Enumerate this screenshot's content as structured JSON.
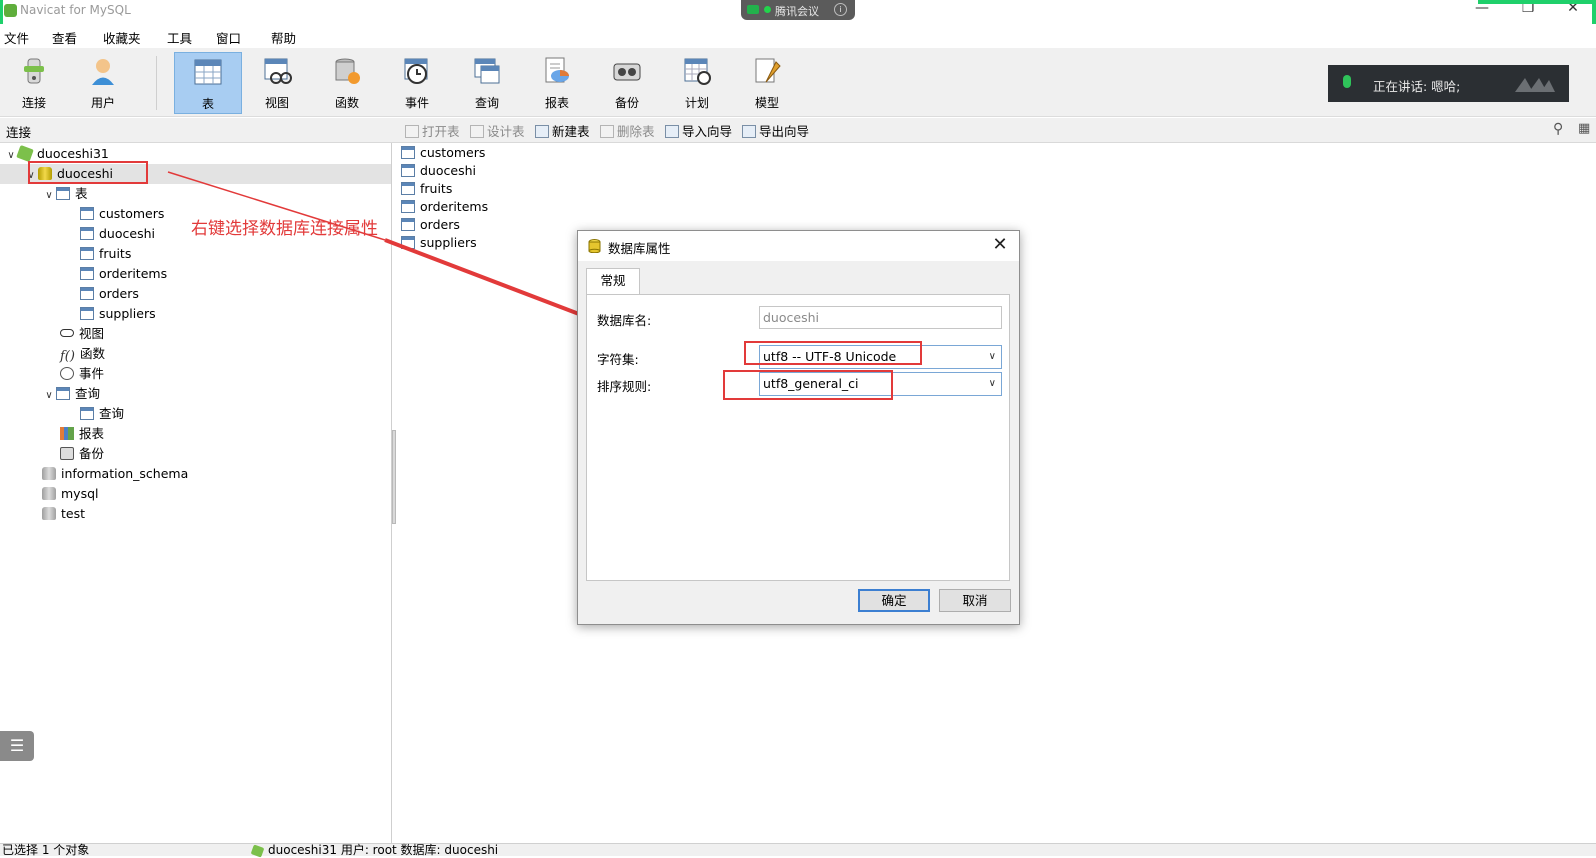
{
  "window": {
    "title": "Navicat for MySQL",
    "controls": [
      "—",
      "❐",
      "✕"
    ]
  },
  "meeting": {
    "label": "腾讯会议",
    "info_icon": "info-icon"
  },
  "menu": {
    "items": [
      "文件",
      "查看",
      "收藏夹",
      "工具",
      "窗口",
      "帮助"
    ]
  },
  "toolbar": {
    "items": [
      {
        "label": "连接",
        "icon": "connection-icon"
      },
      {
        "label": "用户",
        "icon": "user-icon"
      },
      {
        "label": "表",
        "icon": "table-icon",
        "active": true
      },
      {
        "label": "视图",
        "icon": "view-icon"
      },
      {
        "label": "函数",
        "icon": "function-icon"
      },
      {
        "label": "事件",
        "icon": "event-icon"
      },
      {
        "label": "查询",
        "icon": "query-icon"
      },
      {
        "label": "报表",
        "icon": "report-icon"
      },
      {
        "label": "备份",
        "icon": "backup-icon"
      },
      {
        "label": "计划",
        "icon": "schedule-icon"
      },
      {
        "label": "模型",
        "icon": "model-icon"
      }
    ]
  },
  "speaking_banner": {
    "text": "正在讲话: 嗯哈;"
  },
  "connection_header": "连接",
  "subtoolbar": {
    "items": [
      {
        "label": "打开表",
        "enabled": false
      },
      {
        "label": "设计表",
        "enabled": false
      },
      {
        "label": "新建表",
        "enabled": true
      },
      {
        "label": "删除表",
        "enabled": false
      },
      {
        "label": "导入向导",
        "enabled": true
      },
      {
        "label": "导出向导",
        "enabled": true
      }
    ]
  },
  "tree": {
    "connection": "duoceshi31",
    "database": "duoceshi",
    "tables_folder": "表",
    "tables": [
      "customers",
      "duoceshi",
      "fruits",
      "orderitems",
      "orders",
      "suppliers"
    ],
    "views": "视图",
    "functions": "函数",
    "events": "事件",
    "queries_folder": "查询",
    "query_item": "查询",
    "reports": "报表",
    "backups": "备份",
    "other_databases": [
      "information_schema",
      "mysql",
      "test"
    ]
  },
  "table_list": [
    "customers",
    "duoceshi",
    "fruits",
    "orderitems",
    "orders",
    "suppliers"
  ],
  "annotation": {
    "text": "右键选择数据库连接属性",
    "color": "#e23a3a"
  },
  "dialog": {
    "title": "数据库属性",
    "tab": "常规",
    "db_name_label": "数据库名:",
    "db_name_value": "duoceshi",
    "charset_label": "字符集:",
    "charset_value": "utf8 -- UTF-8 Unicode",
    "collation_label": "排序规则:",
    "collation_value": "utf8_general_ci",
    "ok": "确定",
    "cancel": "取消"
  },
  "status": {
    "left": "已选择 1 个对象",
    "right": "duoceshi31    用户: root    数据库: duoceshi"
  },
  "colors": {
    "accent_active": "#a8cdf2",
    "annotation": "#e23a3a",
    "green_edge": "#1fd06b"
  }
}
